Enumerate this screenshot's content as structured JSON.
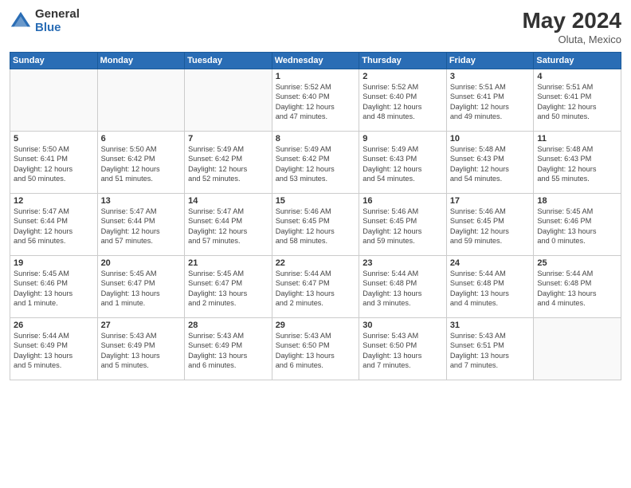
{
  "header": {
    "logo_general": "General",
    "logo_blue": "Blue",
    "month_year": "May 2024",
    "location": "Oluta, Mexico"
  },
  "days_of_week": [
    "Sunday",
    "Monday",
    "Tuesday",
    "Wednesday",
    "Thursday",
    "Friday",
    "Saturday"
  ],
  "weeks": [
    [
      {
        "day": "",
        "info": ""
      },
      {
        "day": "",
        "info": ""
      },
      {
        "day": "",
        "info": ""
      },
      {
        "day": "1",
        "info": "Sunrise: 5:52 AM\nSunset: 6:40 PM\nDaylight: 12 hours\nand 47 minutes."
      },
      {
        "day": "2",
        "info": "Sunrise: 5:52 AM\nSunset: 6:40 PM\nDaylight: 12 hours\nand 48 minutes."
      },
      {
        "day": "3",
        "info": "Sunrise: 5:51 AM\nSunset: 6:41 PM\nDaylight: 12 hours\nand 49 minutes."
      },
      {
        "day": "4",
        "info": "Sunrise: 5:51 AM\nSunset: 6:41 PM\nDaylight: 12 hours\nand 50 minutes."
      }
    ],
    [
      {
        "day": "5",
        "info": "Sunrise: 5:50 AM\nSunset: 6:41 PM\nDaylight: 12 hours\nand 50 minutes."
      },
      {
        "day": "6",
        "info": "Sunrise: 5:50 AM\nSunset: 6:42 PM\nDaylight: 12 hours\nand 51 minutes."
      },
      {
        "day": "7",
        "info": "Sunrise: 5:49 AM\nSunset: 6:42 PM\nDaylight: 12 hours\nand 52 minutes."
      },
      {
        "day": "8",
        "info": "Sunrise: 5:49 AM\nSunset: 6:42 PM\nDaylight: 12 hours\nand 53 minutes."
      },
      {
        "day": "9",
        "info": "Sunrise: 5:49 AM\nSunset: 6:43 PM\nDaylight: 12 hours\nand 54 minutes."
      },
      {
        "day": "10",
        "info": "Sunrise: 5:48 AM\nSunset: 6:43 PM\nDaylight: 12 hours\nand 54 minutes."
      },
      {
        "day": "11",
        "info": "Sunrise: 5:48 AM\nSunset: 6:43 PM\nDaylight: 12 hours\nand 55 minutes."
      }
    ],
    [
      {
        "day": "12",
        "info": "Sunrise: 5:47 AM\nSunset: 6:44 PM\nDaylight: 12 hours\nand 56 minutes."
      },
      {
        "day": "13",
        "info": "Sunrise: 5:47 AM\nSunset: 6:44 PM\nDaylight: 12 hours\nand 57 minutes."
      },
      {
        "day": "14",
        "info": "Sunrise: 5:47 AM\nSunset: 6:44 PM\nDaylight: 12 hours\nand 57 minutes."
      },
      {
        "day": "15",
        "info": "Sunrise: 5:46 AM\nSunset: 6:45 PM\nDaylight: 12 hours\nand 58 minutes."
      },
      {
        "day": "16",
        "info": "Sunrise: 5:46 AM\nSunset: 6:45 PM\nDaylight: 12 hours\nand 59 minutes."
      },
      {
        "day": "17",
        "info": "Sunrise: 5:46 AM\nSunset: 6:45 PM\nDaylight: 12 hours\nand 59 minutes."
      },
      {
        "day": "18",
        "info": "Sunrise: 5:45 AM\nSunset: 6:46 PM\nDaylight: 13 hours\nand 0 minutes."
      }
    ],
    [
      {
        "day": "19",
        "info": "Sunrise: 5:45 AM\nSunset: 6:46 PM\nDaylight: 13 hours\nand 1 minute."
      },
      {
        "day": "20",
        "info": "Sunrise: 5:45 AM\nSunset: 6:47 PM\nDaylight: 13 hours\nand 1 minute."
      },
      {
        "day": "21",
        "info": "Sunrise: 5:45 AM\nSunset: 6:47 PM\nDaylight: 13 hours\nand 2 minutes."
      },
      {
        "day": "22",
        "info": "Sunrise: 5:44 AM\nSunset: 6:47 PM\nDaylight: 13 hours\nand 2 minutes."
      },
      {
        "day": "23",
        "info": "Sunrise: 5:44 AM\nSunset: 6:48 PM\nDaylight: 13 hours\nand 3 minutes."
      },
      {
        "day": "24",
        "info": "Sunrise: 5:44 AM\nSunset: 6:48 PM\nDaylight: 13 hours\nand 4 minutes."
      },
      {
        "day": "25",
        "info": "Sunrise: 5:44 AM\nSunset: 6:48 PM\nDaylight: 13 hours\nand 4 minutes."
      }
    ],
    [
      {
        "day": "26",
        "info": "Sunrise: 5:44 AM\nSunset: 6:49 PM\nDaylight: 13 hours\nand 5 minutes."
      },
      {
        "day": "27",
        "info": "Sunrise: 5:43 AM\nSunset: 6:49 PM\nDaylight: 13 hours\nand 5 minutes."
      },
      {
        "day": "28",
        "info": "Sunrise: 5:43 AM\nSunset: 6:49 PM\nDaylight: 13 hours\nand 6 minutes."
      },
      {
        "day": "29",
        "info": "Sunrise: 5:43 AM\nSunset: 6:50 PM\nDaylight: 13 hours\nand 6 minutes."
      },
      {
        "day": "30",
        "info": "Sunrise: 5:43 AM\nSunset: 6:50 PM\nDaylight: 13 hours\nand 7 minutes."
      },
      {
        "day": "31",
        "info": "Sunrise: 5:43 AM\nSunset: 6:51 PM\nDaylight: 13 hours\nand 7 minutes."
      },
      {
        "day": "",
        "info": ""
      }
    ]
  ]
}
